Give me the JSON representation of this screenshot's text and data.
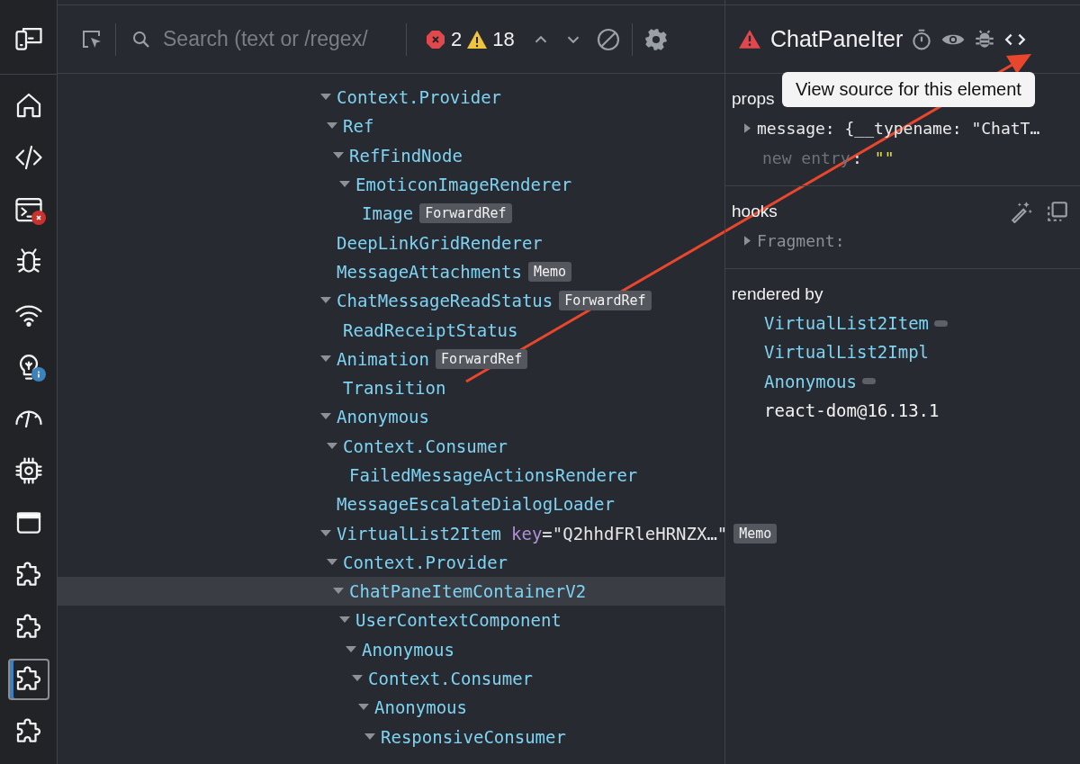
{
  "sidebar": {
    "items": [
      {
        "kind": "device",
        "selected": false
      },
      {
        "kind": "home",
        "selected": false
      },
      {
        "kind": "code",
        "selected": false
      },
      {
        "kind": "console-error",
        "selected": false
      },
      {
        "kind": "bug",
        "selected": false
      },
      {
        "kind": "wifi",
        "selected": false
      },
      {
        "kind": "bulb-info",
        "selected": false
      },
      {
        "kind": "gauge",
        "selected": false
      },
      {
        "kind": "chip",
        "selected": false
      },
      {
        "kind": "window",
        "selected": false
      },
      {
        "kind": "puzzle",
        "selected": false
      },
      {
        "kind": "puzzle",
        "selected": false
      },
      {
        "kind": "puzzle",
        "selected": true
      },
      {
        "kind": "puzzle",
        "selected": false
      }
    ]
  },
  "toolbar": {
    "search": {
      "placeholder": "Search (text or /regex/"
    },
    "error_count": "2",
    "warning_count": "18"
  },
  "tree": [
    {
      "name": "Context.Provider",
      "expanded": true,
      "selected": false,
      "children": [
        {
          "name": "Ref",
          "expanded": true,
          "selected": false,
          "children": [
            {
              "name": "RefFindNode",
              "expanded": true,
              "selected": false,
              "children": [
                {
                  "name": "EmoticonImageRenderer",
                  "expanded": true,
                  "selected": false,
                  "children": [
                    {
                      "name": "Image",
                      "expanded": false,
                      "selected": false,
                      "badges": [
                        "ForwardRef"
                      ]
                    }
                  ]
                }
              ]
            }
          ]
        }
      ]
    },
    {
      "name": "DeepLinkGridRenderer",
      "expanded": false,
      "selected": false
    },
    {
      "name": "MessageAttachments",
      "expanded": false,
      "selected": false,
      "badges": [
        "Memo"
      ]
    },
    {
      "name": "ChatMessageReadStatus",
      "expanded": true,
      "selected": false,
      "badges": [
        "ForwardRef"
      ],
      "children": [
        {
          "name": "ReadReceiptStatus",
          "expanded": false,
          "selected": false
        }
      ]
    },
    {
      "name": "Animation",
      "expanded": true,
      "selected": false,
      "badges": [
        "ForwardRef"
      ],
      "children": [
        {
          "name": "Transition",
          "expanded": false,
          "selected": false
        }
      ]
    },
    {
      "name": "Anonymous",
      "expanded": true,
      "selected": false,
      "children": [
        {
          "name": "Context.Consumer",
          "expanded": true,
          "selected": false,
          "children": [
            {
              "name": "FailedMessageActionsRenderer",
              "expanded": false,
              "selected": false
            }
          ]
        }
      ]
    },
    {
      "name": "MessageEscalateDialogLoader",
      "expanded": false,
      "selected": false
    },
    {
      "name": "VirtualList2Item",
      "expanded": true,
      "selected": false,
      "key": {
        "name": "key",
        "value": "=\"Q2hhdFRleHRNZX…\""
      },
      "badges": [
        "Memo"
      ],
      "children": [
        {
          "name": "Context.Provider",
          "expanded": true,
          "selected": false,
          "children": [
            {
              "name": "ChatPaneItemContainerV2",
              "expanded": true,
              "selected": true,
              "children": [
                {
                  "name": "UserContextComponent",
                  "expanded": true,
                  "selected": false,
                  "children": [
                    {
                      "name": "Anonymous",
                      "expanded": true,
                      "selected": false,
                      "children": [
                        {
                          "name": "Context.Consumer",
                          "expanded": true,
                          "selected": false,
                          "children": [
                            {
                              "name": "Anonymous",
                              "expanded": true,
                              "selected": false,
                              "children": [
                                {
                                  "name": "ResponsiveConsumer",
                                  "expanded": true,
                                  "selected": false
                                }
                              ]
                            }
                          ]
                        }
                      ]
                    }
                  ]
                }
              ]
            }
          ]
        }
      ]
    }
  ],
  "inspector": {
    "title": "ChatPaneIter",
    "tooltip": "View source for this element",
    "props": {
      "label": "props",
      "entries": [
        {
          "text": "message: {__typename: \"ChatT…",
          "expanded": false
        }
      ],
      "new_entry": {
        "placeholder": "new entry",
        "separator": ":",
        "value": "\"\""
      }
    },
    "hooks": {
      "label": "hooks",
      "entries": [
        {
          "text": "Fragment:",
          "expanded": false
        }
      ]
    },
    "rendered_by": {
      "label": "rendered by",
      "items": [
        {
          "name": "VirtualList2Item",
          "kind": "component",
          "pill": true
        },
        {
          "name": "VirtualList2Impl",
          "kind": "component",
          "pill": false
        },
        {
          "name": "Anonymous",
          "kind": "component",
          "pill": true
        },
        {
          "name": "react-dom@16.13.1",
          "kind": "renderer",
          "pill": false
        }
      ]
    }
  }
}
